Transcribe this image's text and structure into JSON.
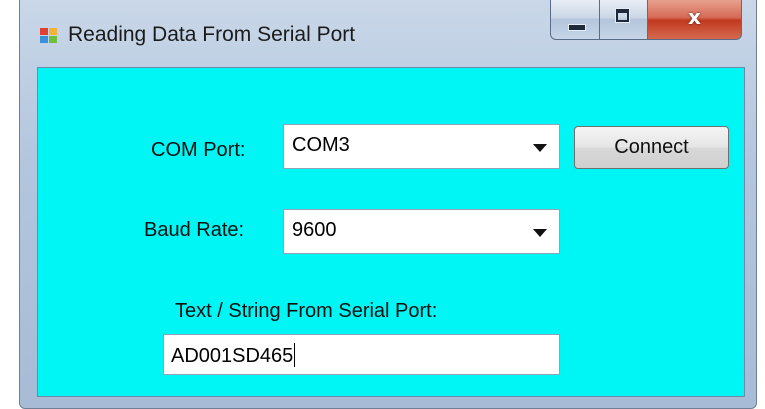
{
  "window": {
    "title": "Reading Data From Serial Port",
    "icon": "winforms-app-icon",
    "caption_buttons": [
      "minimize-icon",
      "maximize-icon",
      "close-icon"
    ],
    "close_glyph": "x"
  },
  "form": {
    "background_color": "#00f5f5",
    "com_port": {
      "label": "COM Port:",
      "selected": "COM3"
    },
    "baud_rate": {
      "label": "Baud Rate:",
      "selected": "9600"
    },
    "connect_label": "Connect",
    "serial_text": {
      "label": "Text / String From Serial Port:",
      "value": "AD001SD465"
    }
  }
}
